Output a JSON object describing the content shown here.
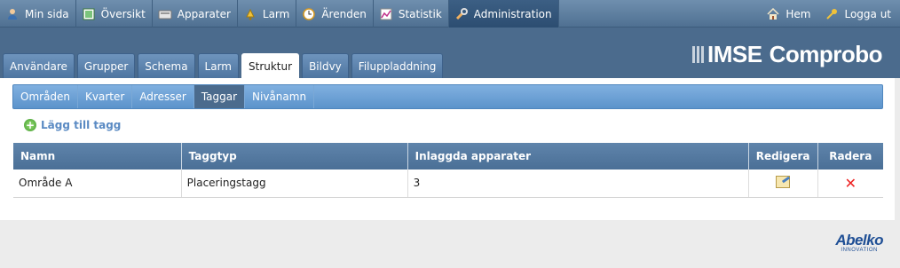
{
  "topnav": {
    "items": [
      {
        "label": "Min sida",
        "icon": "user-icon"
      },
      {
        "label": "Översikt",
        "icon": "overview-icon"
      },
      {
        "label": "Apparater",
        "icon": "device-icon"
      },
      {
        "label": "Larm",
        "icon": "alarm-icon"
      },
      {
        "label": "Ärenden",
        "icon": "clock-icon"
      },
      {
        "label": "Statistik",
        "icon": "chart-icon"
      },
      {
        "label": "Administration",
        "icon": "wrench-icon",
        "active": true
      }
    ],
    "home": {
      "label": "Hem",
      "icon": "home-icon"
    },
    "logout": {
      "label": "Logga ut",
      "icon": "key-icon"
    }
  },
  "brand": {
    "imse": "IMSE",
    "product": "Comprobo"
  },
  "main_tabs": [
    "Användare",
    "Grupper",
    "Schema",
    "Larm",
    "Struktur",
    "Bildvy",
    "Filuppladdning"
  ],
  "main_tab_active": "Struktur",
  "sub_tabs": [
    "Områden",
    "Kvarter",
    "Adresser",
    "Taggar",
    "Nivånamn"
  ],
  "sub_tab_active": "Taggar",
  "add_tag_label": "Lägg till tagg",
  "table": {
    "headers": {
      "name": "Namn",
      "type": "Taggtyp",
      "devices": "Inlaggda apparater",
      "edit": "Redigera",
      "delete": "Radera"
    },
    "rows": [
      {
        "name": "Område A",
        "type": "Placeringstagg",
        "devices": "3"
      }
    ]
  },
  "footer": {
    "brand": "Abelko",
    "tagline": "INNOVATION"
  },
  "colors": {
    "accent": "#4b6b8d",
    "subtab": "#6a9dd2",
    "link": "#5a8ac3",
    "delete": "#e22222"
  }
}
